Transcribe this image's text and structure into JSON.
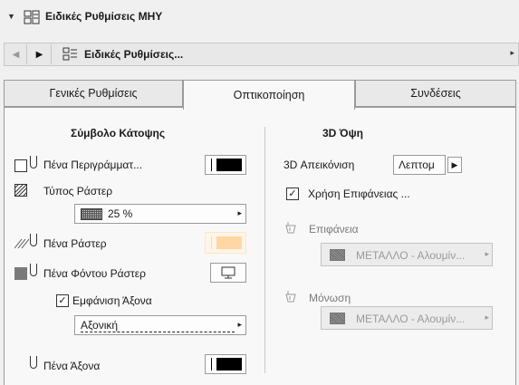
{
  "header": {
    "title": "Ειδικές Ρυθμίσεις ΜΗΥ"
  },
  "nav": {
    "label": "Ειδικές Ρυθμίσεις..."
  },
  "tabs": [
    {
      "label": "Γενικές Ρυθμίσεις"
    },
    {
      "label": "Οπτικοποίηση"
    },
    {
      "label": "Συνδέσεις"
    }
  ],
  "left": {
    "heading": "Σύμβολο Κάτοψης",
    "outline_pen_label": "Πένα Περιγράμματ...",
    "fill_type_label": "Τύπος Ράστερ",
    "fill_type_value": "25 %",
    "fill_pen_label": "Πένα Ράστερ",
    "bg_pen_label": "Πένα Φόντου Ράστερ",
    "show_axis_label": "Εμφάνιση Άξονα",
    "axis_type_value": "Αξονική",
    "axis_pen_label": "Πένα Άξονα"
  },
  "right": {
    "heading": "3D Όψη",
    "display_label": "3D Απεικόνιση",
    "display_value": "Λεπτομ",
    "use_surface_label": "Χρήση Επιφάνειας ...",
    "surface_label": "Επιφάνεια",
    "surface_value": "ΜΕΤΑΛΛΟ - Αλουμίν...",
    "insulation_label": "Μόνωση",
    "insulation_value": "ΜΕΤΑΛΛΟ - Αλουμίν..."
  }
}
